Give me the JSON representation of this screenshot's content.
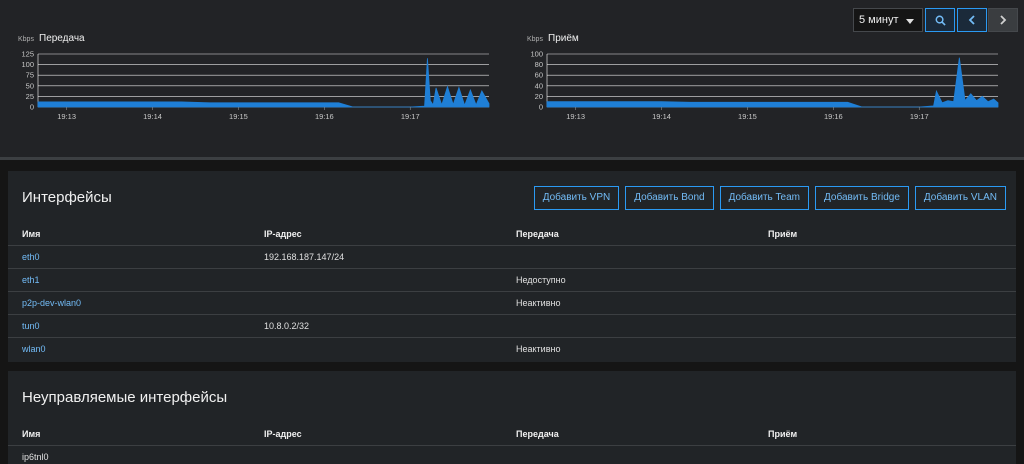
{
  "period": {
    "selected": "5 минут"
  },
  "icons": {
    "zoom": "magnifier-icon",
    "prev": "chevron-left-icon",
    "next": "chevron-right-icon"
  },
  "colors": {
    "accent": "#2b9af3",
    "series": "#1f7fd6",
    "grid": "#ffffff",
    "link": "#73bcf7"
  },
  "chart_data": [
    {
      "type": "area",
      "title": "Передача",
      "unit": "Kbps",
      "x_ticks": [
        "19:13",
        "19:14",
        "19:15",
        "19:16",
        "19:17"
      ],
      "y_ticks": [
        "125",
        "100",
        "75",
        "50",
        "25",
        "0"
      ],
      "ylim": [
        0,
        125
      ],
      "xlim": [
        "19:12:40",
        "19:17:55"
      ],
      "grid": true,
      "series": [
        {
          "x": [
            "19:12:40",
            "19:13:00",
            "19:13:30",
            "19:14:00",
            "19:14:20",
            "19:14:40",
            "19:15:00",
            "19:15:30",
            "19:16:00",
            "19:16:10",
            "19:16:20",
            "19:17:00",
            "19:17:10",
            "19:17:12",
            "19:17:14",
            "19:17:16",
            "19:17:18",
            "19:17:22",
            "19:17:26",
            "19:17:30",
            "19:17:34",
            "19:17:38",
            "19:17:42",
            "19:17:46",
            "19:17:50",
            "19:17:55"
          ],
          "y": [
            12,
            12,
            12,
            12,
            12,
            10,
            10,
            10,
            10,
            10,
            0,
            0,
            2,
            115,
            15,
            5,
            45,
            5,
            48,
            6,
            46,
            4,
            40,
            5,
            38,
            8
          ]
        }
      ]
    },
    {
      "type": "area",
      "title": "Приём",
      "unit": "Kbps",
      "x_ticks": [
        "19:13",
        "19:14",
        "19:15",
        "19:16",
        "19:17"
      ],
      "y_ticks": [
        "100",
        "80",
        "60",
        "40",
        "20",
        "0"
      ],
      "ylim": [
        0,
        100
      ],
      "xlim": [
        "19:12:40",
        "19:17:55"
      ],
      "grid": true,
      "series": [
        {
          "x": [
            "19:12:40",
            "19:13:00",
            "19:14:00",
            "19:14:20",
            "19:15:00",
            "19:16:00",
            "19:16:10",
            "19:16:20",
            "19:17:00",
            "19:17:10",
            "19:17:12",
            "19:17:16",
            "19:17:20",
            "19:17:24",
            "19:17:28",
            "19:17:32",
            "19:17:36",
            "19:17:40",
            "19:17:44",
            "19:17:48",
            "19:17:52",
            "19:17:55"
          ],
          "y": [
            10,
            10,
            10,
            9,
            9,
            9,
            9,
            0,
            0,
            2,
            30,
            8,
            12,
            10,
            93,
            12,
            25,
            12,
            20,
            10,
            15,
            8
          ]
        }
      ]
    }
  ],
  "interfaces": {
    "title": "Интерфейсы",
    "buttons": [
      "Добавить VPN",
      "Добавить Bond",
      "Добавить Team",
      "Добавить Bridge",
      "Добавить VLAN"
    ],
    "columns": [
      "Имя",
      "IP-адрес",
      "Передача",
      "Приём"
    ],
    "rows": [
      {
        "name": "eth0",
        "ip": "192.168.187.147/24",
        "tx": "",
        "rx": ""
      },
      {
        "name": "eth1",
        "ip": "",
        "tx": "Недоступно",
        "rx": ""
      },
      {
        "name": "p2p-dev-wlan0",
        "ip": "",
        "tx": "Неактивно",
        "rx": ""
      },
      {
        "name": "tun0",
        "ip": "10.8.0.2/32",
        "tx": "",
        "rx": ""
      },
      {
        "name": "wlan0",
        "ip": "",
        "tx": "Неактивно",
        "rx": ""
      }
    ]
  },
  "unmanaged": {
    "title": "Неуправляемые интерфейсы",
    "columns": [
      "Имя",
      "IP-адрес",
      "Передача",
      "Приём"
    ],
    "rows": [
      {
        "name": "ip6tnl0",
        "ip": "",
        "tx": "",
        "rx": ""
      }
    ]
  }
}
